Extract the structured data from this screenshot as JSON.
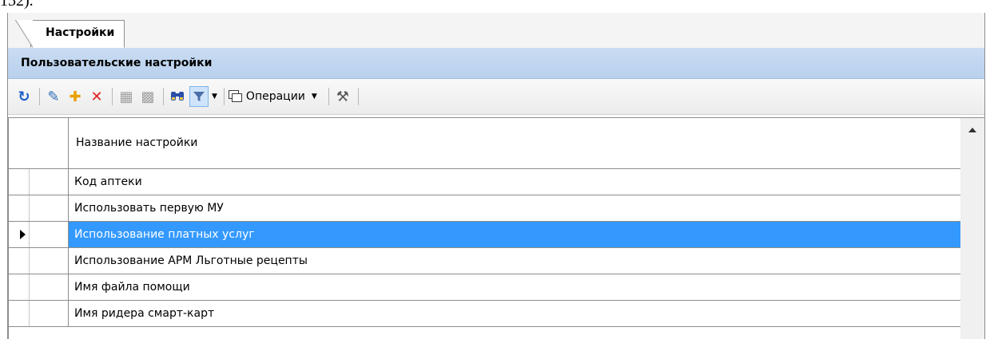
{
  "top_text": "152).",
  "tabs": [
    {
      "label": "Настройки",
      "active": true
    }
  ],
  "panel": {
    "title": "Пользовательские настройки"
  },
  "toolbar": {
    "buttons": [
      {
        "name": "refresh-icon",
        "glyph": "↻",
        "color": "#1a5cc8"
      },
      {
        "name": "edit-icon",
        "glyph": "✎",
        "color": "#2a6bb8"
      },
      {
        "name": "add-icon",
        "glyph": "✚",
        "color": "#e8a000"
      },
      {
        "name": "delete-icon",
        "glyph": "✕",
        "color": "#e02020"
      },
      {
        "name": "save-icon",
        "glyph": "▦",
        "color": "#a0a0a0"
      },
      {
        "name": "save-all-icon",
        "glyph": "▩",
        "color": "#a0a0a0"
      },
      {
        "name": "search-icon",
        "glyph": "⚲",
        "color": "#2a4fa8"
      },
      {
        "name": "filter-icon",
        "glyph": "▼",
        "color": "#3b6fd0"
      }
    ],
    "operations_label": "Операции",
    "tools_icon": "tools-icon"
  },
  "grid": {
    "column_header": "Название настройки",
    "rows": [
      {
        "label": "Код аптеки",
        "selected": false
      },
      {
        "label": "Использовать первую МУ",
        "selected": false
      },
      {
        "label": "Использование платных услуг",
        "selected": true
      },
      {
        "label": "Использование АРМ Льготные рецепты",
        "selected": false
      },
      {
        "label": "Имя файла помощи",
        "selected": false
      },
      {
        "label": "Имя ридера смарт-карт",
        "selected": false
      }
    ]
  },
  "colors": {
    "selection": "#3399ff",
    "panel_header": "#c9dcf2"
  }
}
